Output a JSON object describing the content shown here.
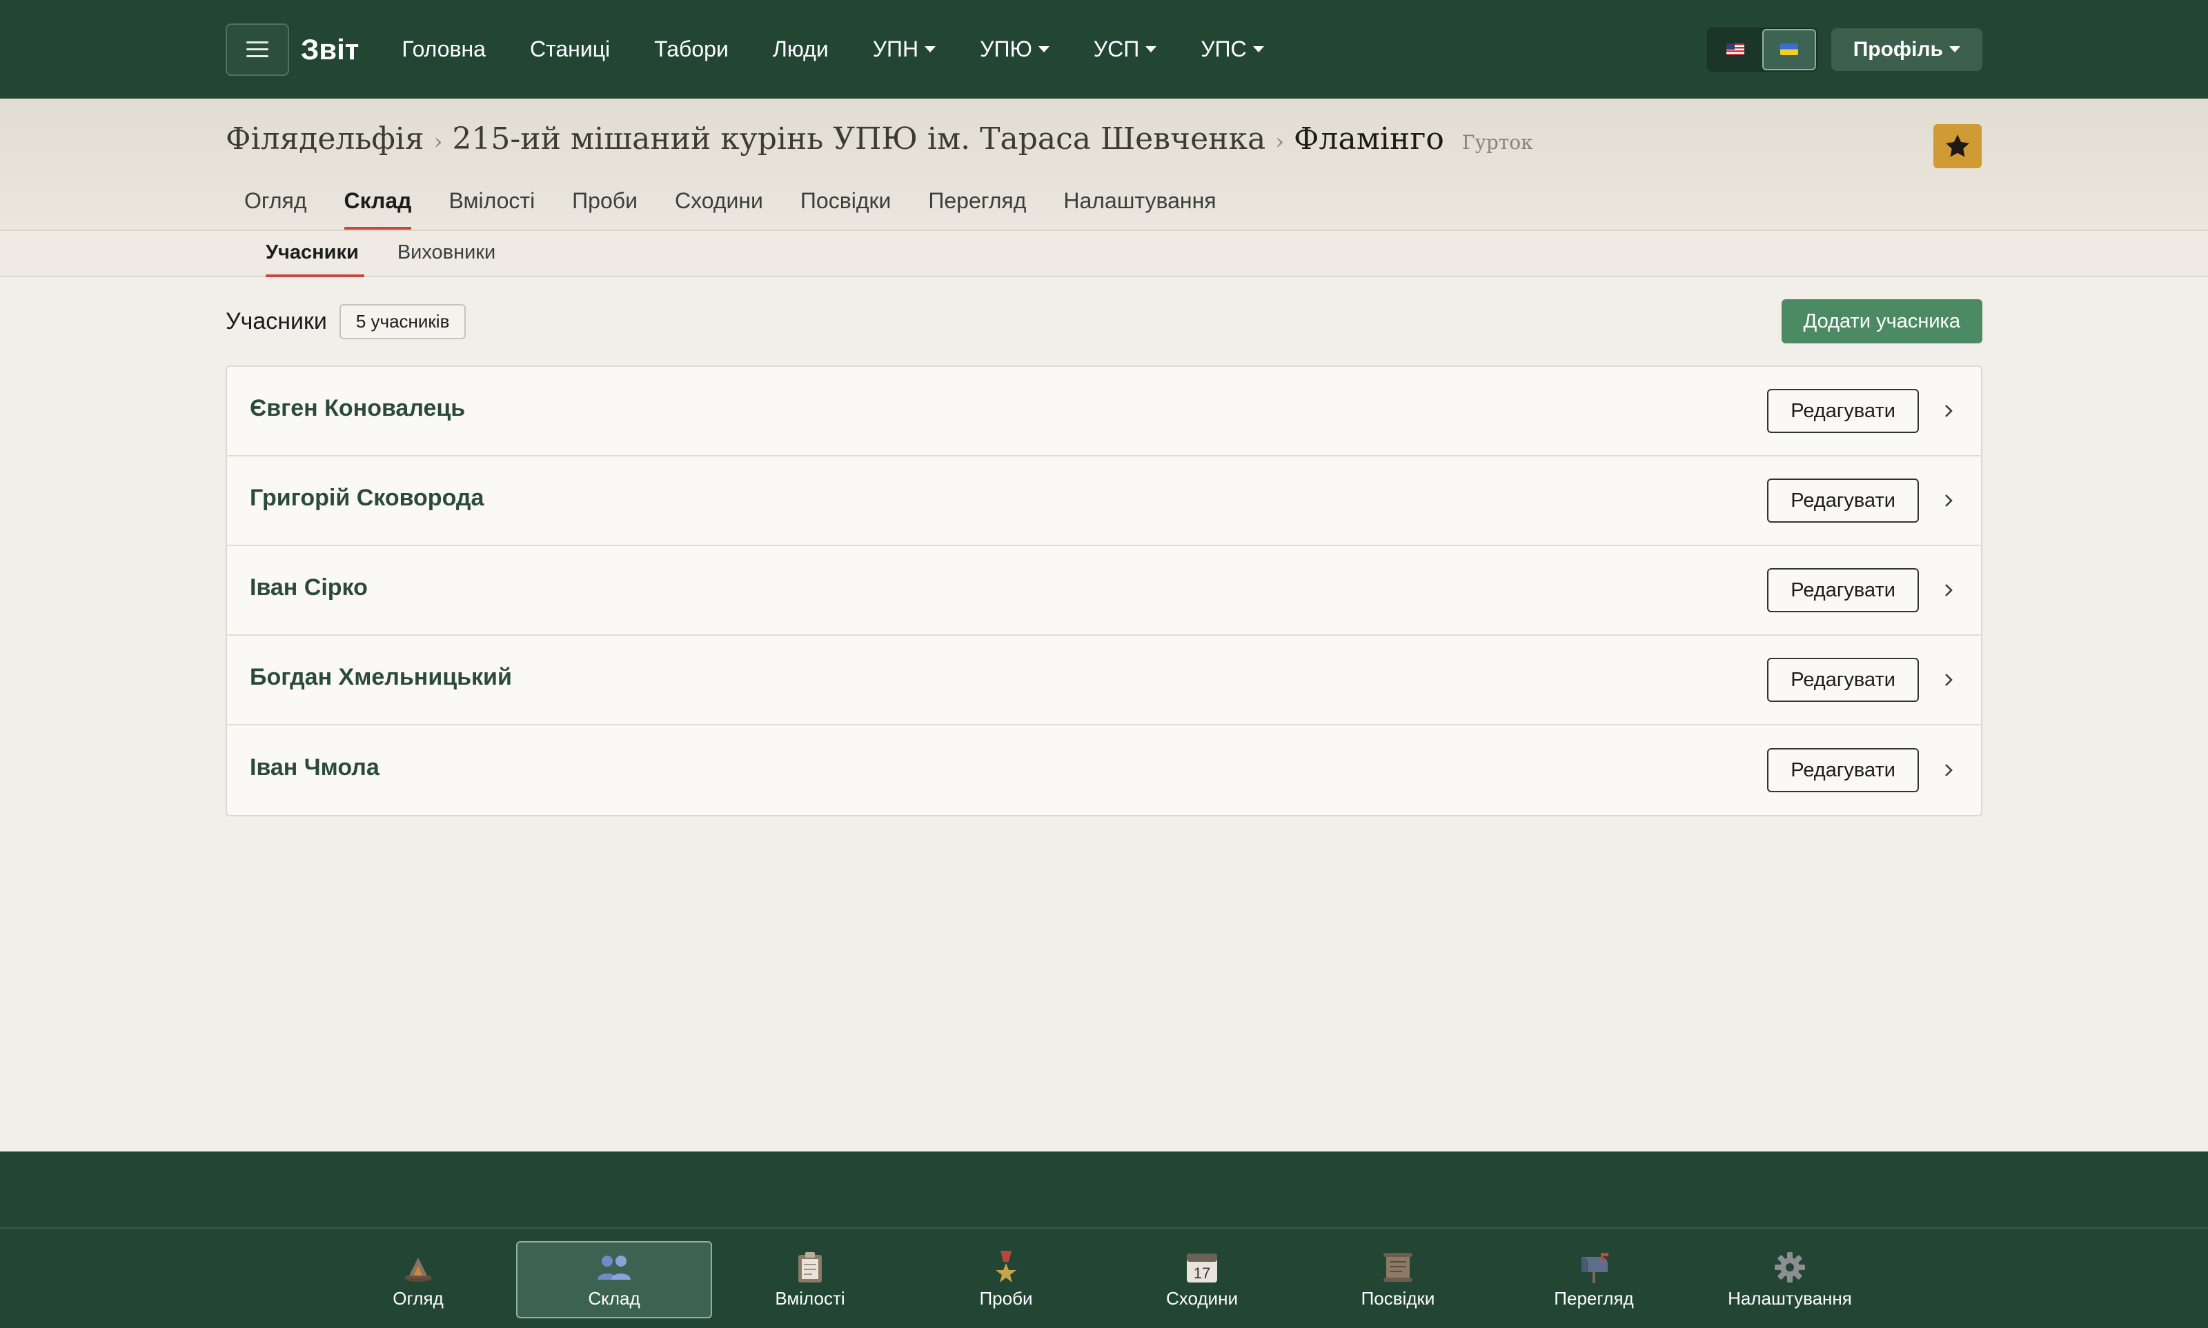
{
  "navbar": {
    "brand": "Звіт",
    "links": [
      {
        "label": "Головна",
        "dropdown": false
      },
      {
        "label": "Станиці",
        "dropdown": false
      },
      {
        "label": "Табори",
        "dropdown": false
      },
      {
        "label": "Люди",
        "dropdown": false
      },
      {
        "label": "УПН",
        "dropdown": true
      },
      {
        "label": "УПЮ",
        "dropdown": true
      },
      {
        "label": "УСП",
        "dropdown": true
      },
      {
        "label": "УПС",
        "dropdown": true
      }
    ],
    "languages": [
      {
        "flag": "us-flag-icon",
        "active": false
      },
      {
        "flag": "ukraine-flag-icon",
        "active": true
      }
    ],
    "profile_label": "Профіль"
  },
  "header": {
    "breadcrumb": [
      "Філядельфія",
      "215-ий мішаний курінь УПЮ ім. Тараса Шевченка"
    ],
    "current": "Фламінго",
    "type": "Гурток",
    "favorite_icon": "star-icon",
    "favorite_color": "#d09a35",
    "tabs": [
      "Огляд",
      "Склад",
      "Вмілості",
      "Проби",
      "Сходини",
      "Посвідки",
      "Перегляд",
      "Налаштування"
    ],
    "active_tab": "Склад"
  },
  "subtabs": {
    "items": [
      "Учасники",
      "Виховники"
    ],
    "active": "Учасники"
  },
  "members": {
    "title": "Учасники",
    "count_label": "5 учасників",
    "add_label": "Додати учасника",
    "edit_label": "Редагувати",
    "list": [
      "Євген Коновалець",
      "Григорій Сковорода",
      "Іван Сірко",
      "Богдан Хмельницький",
      "Іван Чмола"
    ]
  },
  "bottom_nav": {
    "items": [
      {
        "label": "Огляд",
        "icon": "campfire-icon",
        "active": false
      },
      {
        "label": "Склад",
        "icon": "people-icon",
        "active": true
      },
      {
        "label": "Вмілості",
        "icon": "clipboard-icon",
        "active": false
      },
      {
        "label": "Проби",
        "icon": "medal-icon",
        "active": false
      },
      {
        "label": "Сходини",
        "icon": "calendar-icon",
        "active": false
      },
      {
        "label": "Посвідки",
        "icon": "scroll-icon",
        "active": false
      },
      {
        "label": "Перегляд",
        "icon": "mailbox-icon",
        "active": false
      },
      {
        "label": "Налаштування",
        "icon": "gear-icon",
        "active": false
      }
    ],
    "calendar_day": "17"
  },
  "colors": {
    "navbar_bg": "#224534",
    "accent_red": "#c8463d",
    "add_button": "#4c8a64",
    "member_name": "#2c4a3b"
  }
}
